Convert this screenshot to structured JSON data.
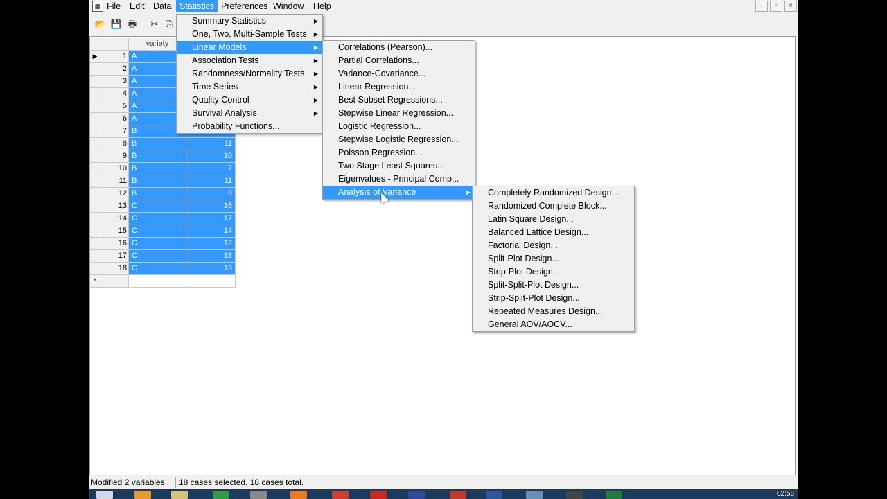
{
  "menubar": {
    "items": [
      {
        "label": "File"
      },
      {
        "label": "Edit"
      },
      {
        "label": "Data"
      },
      {
        "label": "Statistics",
        "active": true
      },
      {
        "label": "Preferences"
      },
      {
        "label": "Window"
      },
      {
        "label": "Help"
      }
    ],
    "window_buttons": [
      "–",
      "▫",
      "×"
    ]
  },
  "toolbar": {
    "icons": [
      "open-icon",
      "save-icon",
      "print-icon",
      "cut-icon",
      "copy-icon"
    ]
  },
  "grid": {
    "column_header": "variety",
    "new_row_marker": "*",
    "rows": [
      {
        "n": "1",
        "variety": "A",
        "value": ""
      },
      {
        "n": "2",
        "variety": "A",
        "value": ""
      },
      {
        "n": "3",
        "variety": "A",
        "value": ""
      },
      {
        "n": "4",
        "variety": "A",
        "value": ""
      },
      {
        "n": "5",
        "variety": "A",
        "value": ""
      },
      {
        "n": "6",
        "variety": "A",
        "value": ""
      },
      {
        "n": "7",
        "variety": "B",
        "value": ""
      },
      {
        "n": "8",
        "variety": "B",
        "value": "11"
      },
      {
        "n": "9",
        "variety": "B",
        "value": "10"
      },
      {
        "n": "10",
        "variety": "B",
        "value": "7"
      },
      {
        "n": "11",
        "variety": "B",
        "value": "11"
      },
      {
        "n": "12",
        "variety": "B",
        "value": "9"
      },
      {
        "n": "13",
        "variety": "C",
        "value": "16"
      },
      {
        "n": "14",
        "variety": "C",
        "value": "17"
      },
      {
        "n": "15",
        "variety": "C",
        "value": "14"
      },
      {
        "n": "16",
        "variety": "C",
        "value": "12"
      },
      {
        "n": "17",
        "variety": "C",
        "value": "18"
      },
      {
        "n": "18",
        "variety": "C",
        "value": "13"
      }
    ]
  },
  "statistics_menu": {
    "items": [
      {
        "label": "Summary Statistics",
        "submenu": true
      },
      {
        "label": "One, Two, Multi-Sample Tests",
        "submenu": true
      },
      {
        "label": "Linear Models",
        "submenu": true,
        "highlighted": true
      },
      {
        "label": "Association Tests",
        "submenu": true
      },
      {
        "label": "Randomness/Normality Tests",
        "submenu": true
      },
      {
        "label": "Time Series",
        "submenu": true
      },
      {
        "label": "Quality Control",
        "submenu": true
      },
      {
        "label": "Survival Analysis",
        "submenu": true
      },
      {
        "label": "Probability Functions...",
        "submenu": false
      }
    ]
  },
  "linear_models_menu": {
    "items": [
      {
        "label": "Correlations (Pearson)..."
      },
      {
        "label": "Partial Correlations..."
      },
      {
        "label": "Variance-Covariance..."
      },
      {
        "label": "Linear Regression..."
      },
      {
        "label": "Best Subset Regressions..."
      },
      {
        "label": "Stepwise Linear Regression..."
      },
      {
        "label": "Logistic Regression..."
      },
      {
        "label": "Stepwise Logistic Regression..."
      },
      {
        "label": "Poisson Regression..."
      },
      {
        "label": "Two Stage Least Squares..."
      },
      {
        "label": "Eigenvalues - Principal Comp..."
      },
      {
        "label": "Analysis of Variance",
        "submenu": true,
        "highlighted": true
      }
    ]
  },
  "anova_menu": {
    "items": [
      {
        "label": "Completely Randomized Design..."
      },
      {
        "label": "Randomized Complete Block..."
      },
      {
        "label": "Latin Square Design..."
      },
      {
        "label": "Balanced Lattice Design..."
      },
      {
        "label": "Factorial Design..."
      },
      {
        "label": "Split-Plot Design..."
      },
      {
        "label": "Strip-Plot Design..."
      },
      {
        "label": "Split-Split-Plot Design..."
      },
      {
        "label": "Strip-Split-Plot Design..."
      },
      {
        "label": "Repeated Measures Design..."
      },
      {
        "label": "General AOV/AOCV..."
      }
    ]
  },
  "statusbar": {
    "left": "Modified 2 variables.",
    "right": "18 cases selected. 18 cases total."
  },
  "taskbar": {
    "clock": "02:58"
  },
  "colors": {
    "highlight": "#3399ff",
    "taskbar": "#1c3a5e"
  }
}
